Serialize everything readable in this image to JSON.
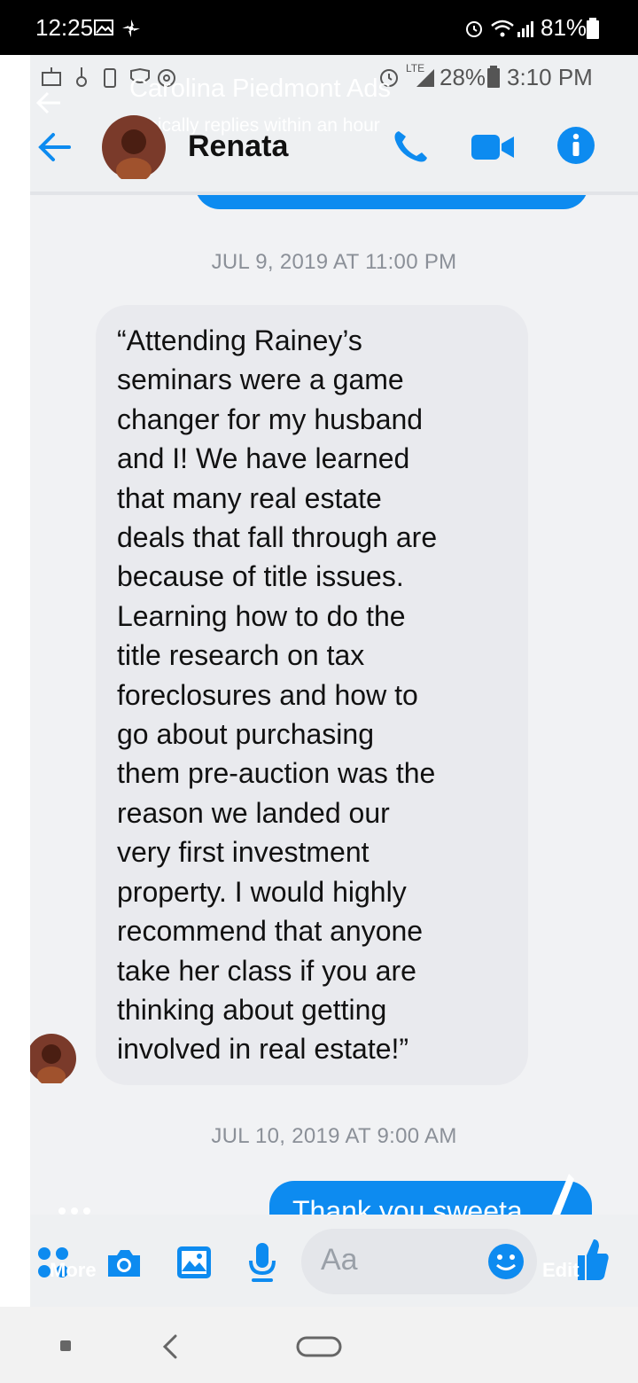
{
  "outer_status": {
    "time": "12:25",
    "battery_pct": "81%"
  },
  "inner_status": {
    "battery_pct": "28%",
    "time": "3:10 PM",
    "network": "LTE"
  },
  "overlay": {
    "title": "Carolina Piedmont Ads",
    "subtitle": "Typically replies within an hour",
    "more_label": "More",
    "edit_label": "Edit"
  },
  "header": {
    "contact_name": "Renata"
  },
  "chat": {
    "date_1": "JUL 9, 2019 AT 11:00 PM",
    "message_lines": [
      "“Attending Rainey’s",
      "seminars were a game",
      "changer for my husband",
      "and I! We have learned",
      "that many real estate",
      "deals that fall through are",
      "because of title issues.",
      "Learning how to do the",
      "title research on tax",
      "foreclosures and how to",
      "go about purchasing",
      "them pre-auction was the",
      "reason we landed our",
      "very first investment",
      "property. I would highly",
      "recommend that anyone",
      "take her class if you are",
      "thinking about getting",
      "involved in real estate!”"
    ],
    "date_2": "JUL 10, 2019 AT 9:00 AM",
    "reply_partial": "Thank you sweeta"
  },
  "composer": {
    "placeholder": "Aa"
  },
  "colors": {
    "accent": "#0d8bf0",
    "bubble_gray": "#e9eaee",
    "status_bar": "#000000"
  },
  "icons": [
    "gallery-icon",
    "pinwheel-icon",
    "alarm-icon",
    "wifi-icon",
    "signal-icon",
    "battery-icon",
    "back-arrow-icon",
    "phone-icon",
    "video-icon",
    "info-icon",
    "camera-icon",
    "image-icon",
    "microphone-icon",
    "emoji-icon",
    "thumbs-up-icon",
    "pencil-icon",
    "dots-icon",
    "recents-icon",
    "nav-back-icon",
    "home-icon"
  ]
}
